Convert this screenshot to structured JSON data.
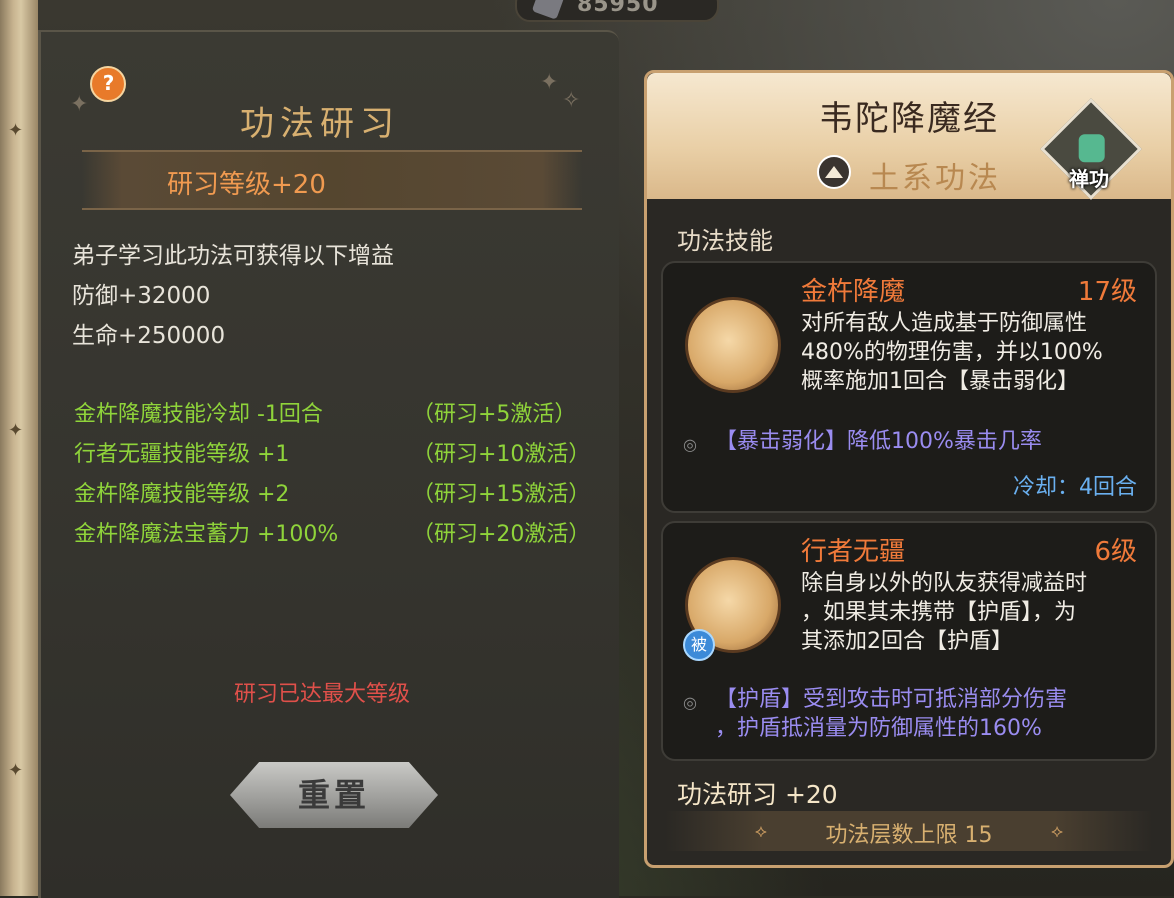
{
  "top_bar": {
    "currency_value": "85950"
  },
  "left_page": {
    "help_icon": "?",
    "title": "功法研习",
    "level_label": "研习等级+20",
    "intro": "弟子学习此功法可获得以下增益",
    "stats": [
      "防御+32000",
      "生命+250000"
    ],
    "bonuses": [
      {
        "effect": "金杵降魔技能冷却 -1回合",
        "requirement": "（研习+5激活）"
      },
      {
        "effect": "行者无疆技能等级 +1",
        "requirement": "（研习+10激活）"
      },
      {
        "effect": "金杵降魔技能等级 +2",
        "requirement": "（研习+15激活）"
      },
      {
        "effect": "金杵降魔法宝蓄力 +100%",
        "requirement": "（研习+20激活）"
      }
    ],
    "max_level_notice": "研习已达最大等级",
    "reset_button": "重置"
  },
  "right_panel": {
    "title": "韦陀降魔经",
    "element": "土系功法",
    "type_badge": "禅功",
    "skills_header": "功法技能",
    "skills": [
      {
        "name": "金杵降魔",
        "level": "17级",
        "desc": [
          "对所有敌人造成基于防御属性",
          "480%的物理伤害，并以100%",
          "概率施加1回合【暴击弱化】"
        ],
        "effect": [
          "【暴击弱化】降低100%暴击几率"
        ],
        "cooldown": "冷却：4回合"
      },
      {
        "name": "行者无疆",
        "level": "6级",
        "passive_tag": "被",
        "desc": [
          "除自身以外的队友获得减益时",
          "，如果其未携带【护盾】，为",
          "其添加2回合【护盾】"
        ],
        "effect": [
          "【护盾】受到攻击时可抵消部分伤害",
          "，护盾抵消量为防御属性的160%"
        ]
      }
    ],
    "research_label": "功法研习 +20",
    "layer_limit": "功法层数上限 15"
  },
  "colors": {
    "title_gold": "#d8b070",
    "level_orange": "#f09a50",
    "bonus_green": "#8fd43a",
    "warning_red": "#e0504a",
    "skill_orange": "#f07a3a",
    "effect_purple": "#9a8cf0",
    "cooldown_blue": "#6ab0f0"
  }
}
